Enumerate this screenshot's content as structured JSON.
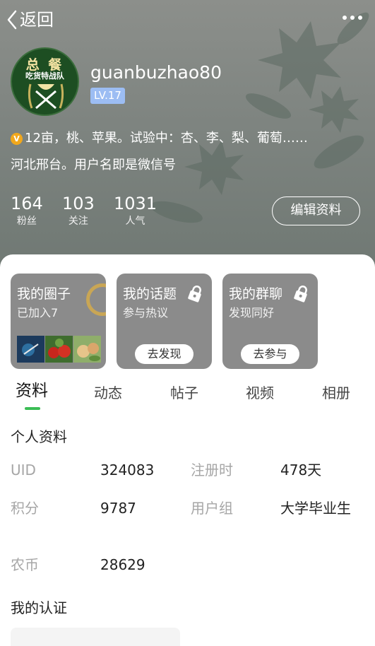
{
  "nav": {
    "back_label": "返回",
    "more_icon": "more-dots-icon"
  },
  "profile": {
    "avatar_title": "总 餐",
    "avatar_subtitle": "吃货特战队",
    "username": "guanbuzhao80",
    "level": "LV.17",
    "bio_icon_glyph": "V",
    "bio": "12亩，桃、苹果。试验中：杏、李、梨、葡萄……",
    "location": "河北邢台。用户名即是微信号",
    "edit_label": "编辑资料"
  },
  "stats": [
    {
      "value": "164",
      "label": "粉丝"
    },
    {
      "value": "103",
      "label": "关注"
    },
    {
      "value": "1031",
      "label": "人气"
    }
  ],
  "cards": [
    {
      "title": "我的圈子",
      "subtitle": "已加入7"
    },
    {
      "title": "我的话题",
      "subtitle": "参与热议",
      "button": "去发现"
    },
    {
      "title": "我的群聊",
      "subtitle": "发现同好",
      "button": "去参与"
    }
  ],
  "tabs": [
    {
      "label": "资料",
      "active": true
    },
    {
      "label": "动态"
    },
    {
      "label": "帖子"
    },
    {
      "label": "视频"
    },
    {
      "label": "相册"
    }
  ],
  "personal_info": {
    "title": "个人资料",
    "fields": [
      {
        "label": "UID",
        "value": "324083"
      },
      {
        "label": "注册时",
        "value": "478天"
      },
      {
        "label": "积分",
        "value": "9787"
      },
      {
        "label": "用户组",
        "value": "大学毕业生"
      },
      {
        "label": "农币",
        "value": "28629"
      }
    ]
  },
  "certification": {
    "title": "我的认证"
  },
  "colors": {
    "accent_green": "#3bbd55",
    "level_badge": "#9cbdf3",
    "card_gray": "#8b8b8b"
  }
}
